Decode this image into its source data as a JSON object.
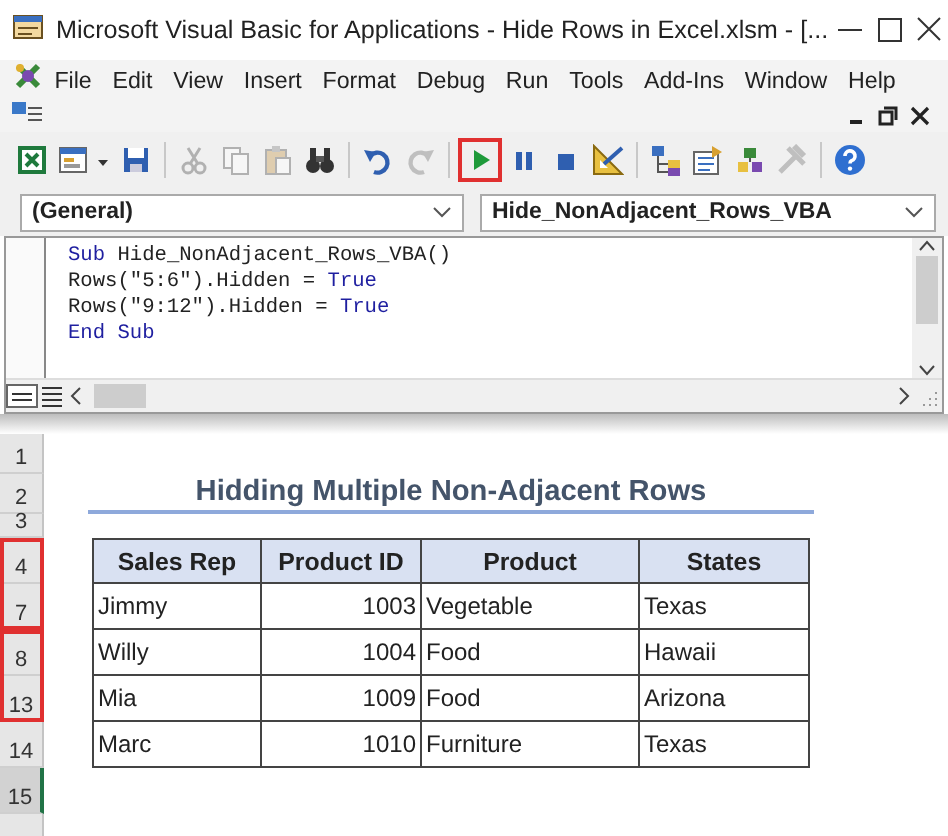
{
  "window": {
    "title": "Microsoft Visual Basic for Applications - Hide Rows in Excel.xlsm - [..."
  },
  "menu": [
    {
      "label": "File"
    },
    {
      "label": "Edit"
    },
    {
      "label": "View"
    },
    {
      "label": "Insert"
    },
    {
      "label": "Format"
    },
    {
      "label": "Debug"
    },
    {
      "label": "Run"
    },
    {
      "label": "Tools"
    },
    {
      "label": "Add-Ins"
    },
    {
      "label": "Window"
    },
    {
      "label": "Help"
    }
  ],
  "toolbar": [
    [
      {
        "kind": "excel",
        "disabled": false,
        "highlighted": false
      },
      {
        "kind": "userform",
        "disabled": false,
        "highlighted": false
      },
      {
        "kind": "save",
        "disabled": false,
        "highlighted": false
      }
    ],
    [
      {
        "kind": "cut",
        "disabled": true,
        "highlighted": false
      },
      {
        "kind": "copy",
        "disabled": true,
        "highlighted": false
      },
      {
        "kind": "paste",
        "disabled": true,
        "highlighted": false
      },
      {
        "kind": "find",
        "disabled": false,
        "highlighted": false
      }
    ],
    [
      {
        "kind": "undo",
        "disabled": false,
        "highlighted": false
      },
      {
        "kind": "redo",
        "disabled": true,
        "highlighted": false
      }
    ],
    [
      {
        "kind": "run",
        "disabled": false,
        "highlighted": true
      },
      {
        "kind": "break",
        "disabled": false,
        "highlighted": false
      },
      {
        "kind": "reset",
        "disabled": false,
        "highlighted": false
      },
      {
        "kind": "design",
        "disabled": false,
        "highlighted": false
      }
    ],
    [
      {
        "kind": "project",
        "disabled": false,
        "highlighted": false
      },
      {
        "kind": "properties",
        "disabled": false,
        "highlighted": false
      },
      {
        "kind": "browser",
        "disabled": false,
        "highlighted": false
      },
      {
        "kind": "toolbox",
        "disabled": true,
        "highlighted": false
      }
    ],
    [
      {
        "kind": "help",
        "disabled": false,
        "highlighted": false
      }
    ]
  ],
  "object_box": {
    "value": "(General)"
  },
  "procedure_box": {
    "value": "Hide_NonAdjacent_Rows_VBA"
  },
  "code": [
    [
      {
        "kind": "keyword",
        "text": "Sub"
      },
      {
        "kind": "plain",
        "text": " Hide_NonAdjacent_Rows_VBA()"
      }
    ],
    [
      {
        "kind": "plain",
        "text": "Rows(\"5:6\").Hidden = "
      },
      {
        "kind": "keyword",
        "text": "True"
      }
    ],
    [
      {
        "kind": "plain",
        "text": "Rows(\"9:12\").Hidden = "
      },
      {
        "kind": "keyword",
        "text": "True"
      }
    ],
    [
      {
        "kind": "keyword",
        "text": "End Sub"
      }
    ]
  ],
  "sheet": {
    "row_groups": [
      {
        "marked": false,
        "rows": [
          {
            "label": "1",
            "selected": false
          }
        ]
      },
      {
        "marked": false,
        "rows": [
          {
            "label": "2",
            "selected": false
          }
        ]
      },
      {
        "marked": false,
        "rows": [
          {
            "label": "3",
            "selected": false
          }
        ]
      },
      {
        "marked": true,
        "rows": [
          {
            "label": "4",
            "selected": false
          },
          {
            "label": "7",
            "selected": false
          }
        ]
      },
      {
        "marked": true,
        "rows": [
          {
            "label": "8",
            "selected": false
          },
          {
            "label": "13",
            "selected": false
          }
        ]
      },
      {
        "marked": false,
        "rows": [
          {
            "label": "14",
            "selected": false
          }
        ]
      },
      {
        "marked": false,
        "rows": [
          {
            "label": "15",
            "selected": true
          }
        ]
      }
    ],
    "title": "Hidding Multiple Non-Adjacent Rows",
    "table": {
      "columns": [
        {
          "label": "Sales Rep",
          "kind": "text"
        },
        {
          "label": "Product ID",
          "kind": "number"
        },
        {
          "label": "Product",
          "kind": "text"
        },
        {
          "label": "States",
          "kind": "text"
        }
      ],
      "rows": [
        [
          "Jimmy",
          "1003",
          "Vegetable",
          "Texas"
        ],
        [
          "Willy",
          "1004",
          "Food",
          "Hawaii"
        ],
        [
          "Mia",
          "1009",
          "Food",
          "Arizona"
        ],
        [
          "Marc",
          "1010",
          "Furniture",
          "Texas"
        ]
      ]
    }
  }
}
